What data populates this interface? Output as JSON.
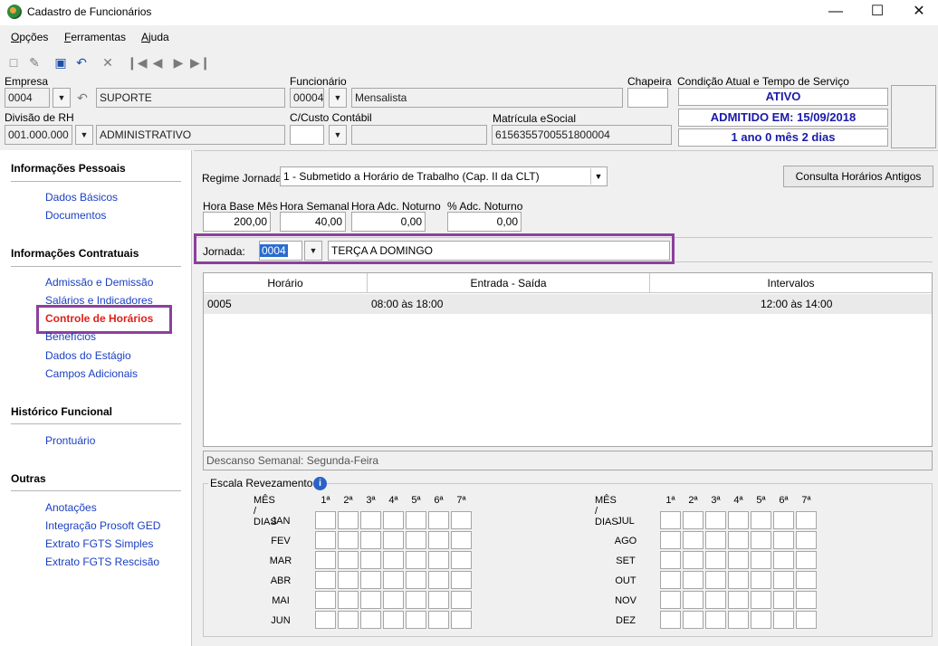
{
  "window": {
    "title": "Cadastro de Funcionários"
  },
  "menu": [
    {
      "key": "O",
      "rest": "pções"
    },
    {
      "key": "F",
      "rest": "erramentas"
    },
    {
      "key": "A",
      "rest": "juda"
    }
  ],
  "header": {
    "empresa": {
      "label": "Empresa",
      "code": "0004",
      "name": "SUPORTE"
    },
    "funcionario": {
      "label": "Funcionário",
      "code": "00004",
      "name": "Mensalista"
    },
    "chapeira": {
      "label": "Chapeira",
      "value": ""
    },
    "condicao": {
      "label": "Condição Atual e Tempo de Serviço",
      "status": "ATIVO",
      "admissao": "ADMITIDO EM: 15/09/2018",
      "tempo": "1 ano 0 mês 2 dias"
    },
    "divisao": {
      "label": "Divisão de RH",
      "code": "001.000.000",
      "name": "ADMINISTRATIVO"
    },
    "ccusto": {
      "label": "C/Custo Contábil",
      "code": "",
      "name": ""
    },
    "matricula": {
      "label": "Matrícula eSocial",
      "value": "6156355700551800004"
    }
  },
  "sidebar": {
    "sections": [
      {
        "title": "Informações Pessoais",
        "items": [
          "Dados Básicos",
          "Documentos"
        ]
      },
      {
        "title": "Informações Contratuais",
        "items": [
          "Admissão e Demissão",
          "Salários e Indicadores",
          "Controle de Horários",
          "Benefícios",
          "Dados do Estágio",
          "Campos Adicionais"
        ]
      },
      {
        "title": "Histórico Funcional",
        "items": [
          "Prontuário"
        ]
      },
      {
        "title": "Outras",
        "items": [
          "Anotações",
          "Integração Prosoft GED",
          "Extrato FGTS Simples",
          "Extrato FGTS Rescisão"
        ]
      }
    ],
    "active_item": "Controle de Horários"
  },
  "main": {
    "regime_label": "Regime Jornada",
    "regime_value": "1 - Submetido a Horário de Trabalho (Cap. II da CLT)",
    "consulta_button": "Consulta Horários Antigos",
    "hours": {
      "base_mes_label": "Hora Base Mês",
      "base_mes": "200,00",
      "semanal_label": "Hora Semanal",
      "semanal": "40,00",
      "adc_noturno_label": "Hora Adc. Noturno",
      "adc_noturno": "0,00",
      "pct_noturno_label": "% Adc. Noturno",
      "pct_noturno": "0,00"
    },
    "jornada_label": "Jornada:",
    "jornada_code": "0004",
    "jornada_name": "TERÇA A DOMINGO",
    "grid": {
      "headers": [
        "Horário",
        "Entrada - Saída",
        "Intervalos"
      ],
      "rows": [
        {
          "horario": "0005",
          "entrada_saida": "08:00 às 18:00",
          "intervalos": "12:00 às 14:00"
        }
      ]
    },
    "descanso": "Descanso Semanal: Segunda-Feira",
    "escala": {
      "title": "Escala Revezamento",
      "header": "MÊS / DIAS",
      "days": [
        "1ª",
        "2ª",
        "3ª",
        "4ª",
        "5ª",
        "6ª",
        "7ª"
      ],
      "months_left": [
        "JAN",
        "FEV",
        "MAR",
        "ABR",
        "MAI",
        "JUN"
      ],
      "months_right": [
        "JUL",
        "AGO",
        "SET",
        "OUT",
        "NOV",
        "DEZ"
      ]
    }
  },
  "colors": {
    "link": "#1a3fc2",
    "active_link": "#e0201a",
    "highlight_box": "#8c3f9e",
    "status_text": "#1a1aa8"
  }
}
